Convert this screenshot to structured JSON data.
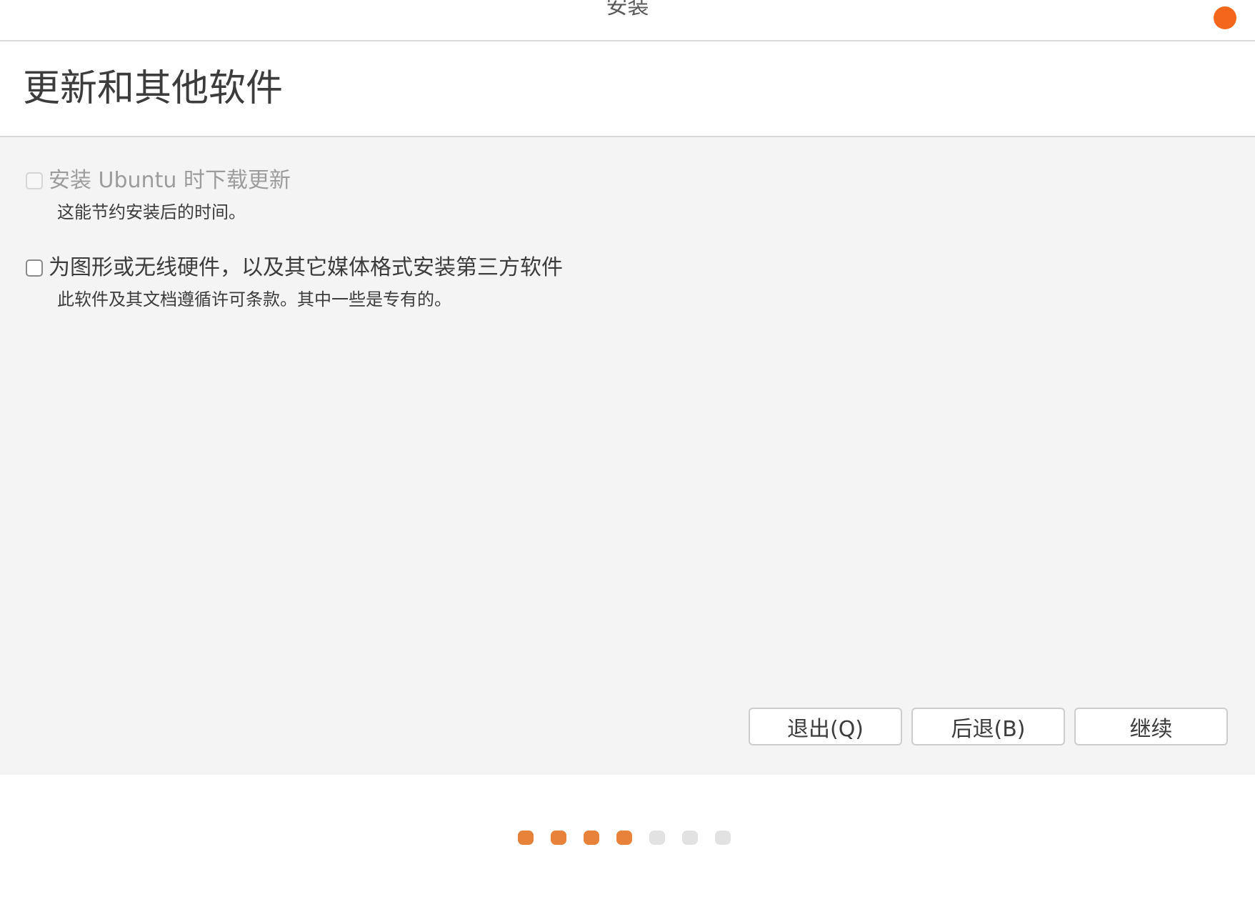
{
  "window": {
    "title": "安装",
    "close_color": "#f4661b"
  },
  "header": {
    "title": "更新和其他软件"
  },
  "options": [
    {
      "label": "安装 Ubuntu 时下载更新",
      "description": "这能节约安装后的时间。",
      "checked": false,
      "disabled": true
    },
    {
      "label": "为图形或无线硬件，以及其它媒体格式安装第三方软件",
      "description": "此软件及其文档遵循许可条款。其中一些是专有的。",
      "checked": false,
      "disabled": false
    }
  ],
  "buttons": {
    "quit_label": "退出(Q)",
    "back_label": "后退(B)",
    "continue_label": "继续"
  },
  "progress": {
    "total_steps": 7,
    "completed_steps": 4,
    "done_color": "#e8823a",
    "pending_color": "#e2e2e2"
  }
}
